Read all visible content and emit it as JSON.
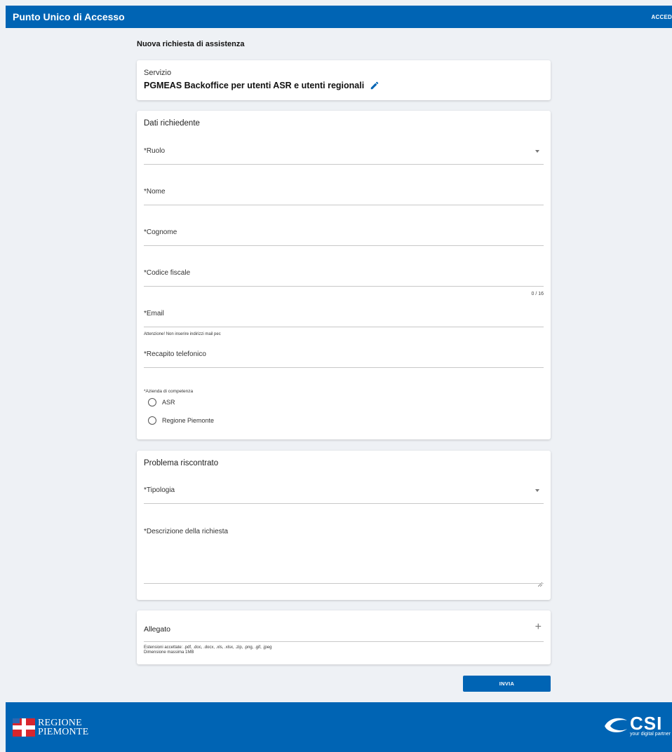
{
  "header": {
    "app_title": "Punto Unico di Accesso",
    "login_label": "ACCED"
  },
  "page": {
    "heading": "Nuova richiesta di assistenza"
  },
  "service": {
    "label": "Servizio",
    "name": "PGMEAS Backoffice per utenti ASR e utenti regionali"
  },
  "requester": {
    "title": "Dati richiedente",
    "role_label": "*Ruolo",
    "first_name_label": "*Nome",
    "last_name_label": "*Cognome",
    "tax_code_label": "*Codice fiscale",
    "tax_code_counter": "0 / 16",
    "email_label": "*Email",
    "email_hint": "Attenzione! Non inserire indirizzi mail pec",
    "phone_label": "*Recapito telefonico",
    "company_label": "*Azienda di competenza",
    "company_options": [
      "ASR",
      "Regione Piemonte"
    ]
  },
  "problem": {
    "title": "Problema riscontrato",
    "type_label": "*Tipologia",
    "description_label": "*Descrizione della richiesta"
  },
  "attachment": {
    "title": "Allegato",
    "extensions_hint": "Estensioni accettate: .pdf, .doc, .docx, .xls, .xlsx, .zip, .png, .gif, .jpeg",
    "size_hint": "Dimensione massima 1MB"
  },
  "actions": {
    "submit_label": "INVIA"
  },
  "footer": {
    "regione_line1": "REGIONE",
    "regione_line2": "PIEMONTE",
    "csi_name": "CSI",
    "csi_tagline": "your digital partner"
  },
  "colors": {
    "primary": "#0064b4",
    "background": "#eef1f5",
    "logo_red": "#d8262e"
  },
  "icons": {
    "edit": "pencil-icon",
    "dropdown": "caret-down-icon",
    "add": "plus-icon"
  }
}
